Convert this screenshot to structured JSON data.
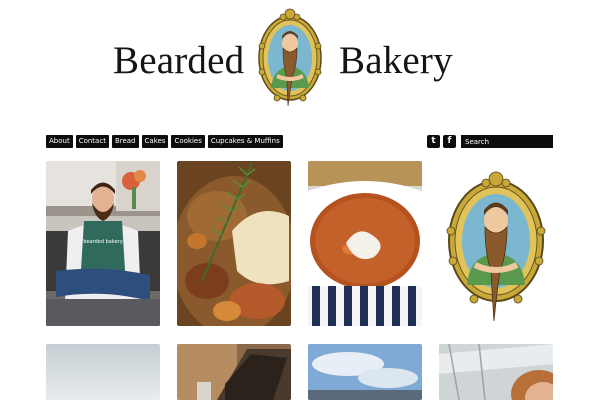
{
  "site": {
    "title_left": "Bearded",
    "title_right": "Bakery",
    "logo_icon": "bearded-baker-cameo-icon"
  },
  "nav": {
    "items": [
      {
        "label": "About"
      },
      {
        "label": "Contact"
      },
      {
        "label": "Bread"
      },
      {
        "label": "Cakes"
      },
      {
        "label": "Cookies"
      },
      {
        "label": "Cupcakes & Muffins"
      }
    ]
  },
  "social": {
    "tumblr_glyph": "t",
    "facebook_glyph": "f"
  },
  "search": {
    "placeholder": "Search"
  },
  "apron_text": "bearded bakery",
  "colors": {
    "nav_bg": "#0d0d0d",
    "nav_text": "#ffffff",
    "title": "#151515"
  }
}
